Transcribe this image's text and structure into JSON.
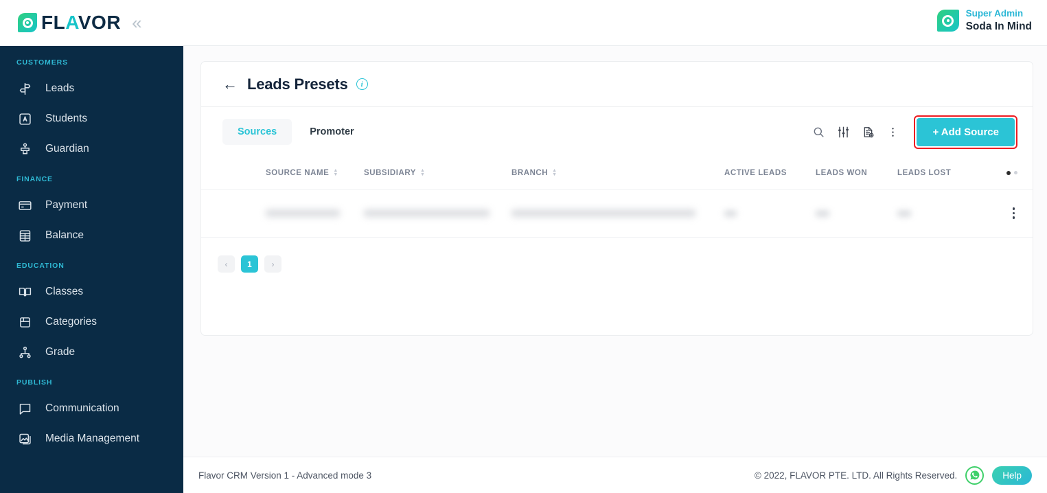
{
  "brand": {
    "name_dark1": "FL",
    "name_teal": "A",
    "name_dark2": "VOR",
    "collapse_glyph": "«"
  },
  "user": {
    "role": "Super Admin",
    "name": "Soda In Mind"
  },
  "sidebar": {
    "groups": [
      {
        "label": "CUSTOMERS",
        "items": [
          {
            "label": "Leads",
            "icon": "signpost-icon"
          },
          {
            "label": "Students",
            "icon": "id-card-icon"
          },
          {
            "label": "Guardian",
            "icon": "guardian-icon"
          }
        ]
      },
      {
        "label": "FINANCE",
        "items": [
          {
            "label": "Payment",
            "icon": "credit-card-icon"
          },
          {
            "label": "Balance",
            "icon": "ledger-icon"
          }
        ]
      },
      {
        "label": "EDUCATION",
        "items": [
          {
            "label": "Classes",
            "icon": "book-icon"
          },
          {
            "label": "Categories",
            "icon": "box-icon"
          },
          {
            "label": "Grade",
            "icon": "hierarchy-icon"
          }
        ]
      },
      {
        "label": "PUBLISH",
        "items": [
          {
            "label": "Communication",
            "icon": "chat-icon"
          },
          {
            "label": "Media Management",
            "icon": "media-icon"
          }
        ]
      }
    ]
  },
  "page": {
    "back_glyph": "←",
    "title": "Leads Presets",
    "info_glyph": "i"
  },
  "toolbar": {
    "tabs": [
      {
        "label": "Sources",
        "active": true
      },
      {
        "label": "Promoter",
        "active": false
      }
    ],
    "icons": [
      "search-icon",
      "filter-icon",
      "export-document-icon",
      "more-options-icon"
    ],
    "add_button": "+ Add Source",
    "add_button_highlight_color": "#ee1c22",
    "accent_color": "#2bc4d6"
  },
  "table": {
    "columns": [
      "SOURCE NAME",
      "SUBSIDIARY",
      "BRANCH",
      "ACTIVE LEADS",
      "LEADS WON",
      "LEADS LOST"
    ],
    "rows": [
      {
        "source_name": "",
        "subsidiary": "",
        "branch": "",
        "active_leads": "",
        "leads_won": "",
        "leads_lost": "",
        "redacted": true
      }
    ]
  },
  "pagination": {
    "prev_glyph": "‹",
    "next_glyph": "›",
    "pages": [
      "1"
    ],
    "current": "1"
  },
  "footer": {
    "version": "Flavor CRM Version 1 - Advanced mode 3",
    "copyright": "© 2022, FLAVOR PTE. LTD. All Rights Reserved.",
    "whatsapp_icon": "whatsapp-icon",
    "help_label": "Help"
  }
}
